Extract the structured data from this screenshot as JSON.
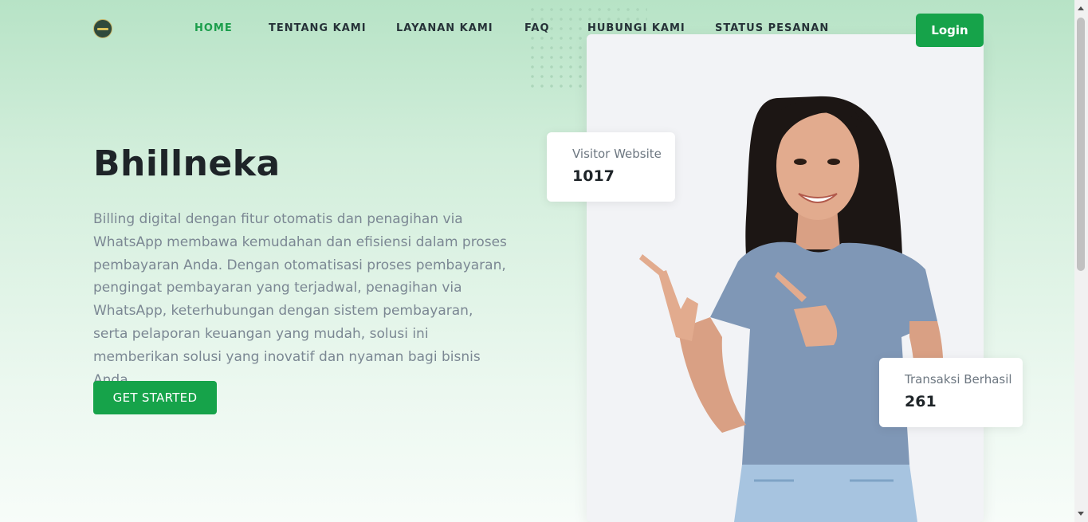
{
  "nav": {
    "items": [
      {
        "label": "HOME",
        "active": true
      },
      {
        "label": "TENTANG KAMI"
      },
      {
        "label": "LAYANAN KAMI"
      },
      {
        "label": "FAQ"
      },
      {
        "label": "HUBUNGI KAMI"
      },
      {
        "label": "STATUS PESANAN"
      }
    ],
    "login_label": "Login"
  },
  "hero": {
    "title": "Bhillneka",
    "description": "Billing digital dengan fitur otomatis dan penagihan via WhatsApp membawa kemudahan dan efisiensi dalam proses pembayaran Anda. Dengan otomatisasi proses pembayaran, pengingat pembayaran yang terjadwal, penagihan via WhatsApp, keterhubungan dengan sistem pembayaran, serta pelaporan keuangan yang mudah, solusi ini memberikan solusi yang inovatif dan nyaman bagi bisnis Anda.",
    "cta_label": "GET STARTED"
  },
  "stats": {
    "visitor": {
      "label": "Visitor Website",
      "value": "1017"
    },
    "transactions": {
      "label": "Transaksi Berhasil",
      "value": "261"
    }
  },
  "colors": {
    "accent": "#16a34a",
    "nav_active": "#1b9e4b",
    "hero_bg_top": "#b7e3c6"
  }
}
